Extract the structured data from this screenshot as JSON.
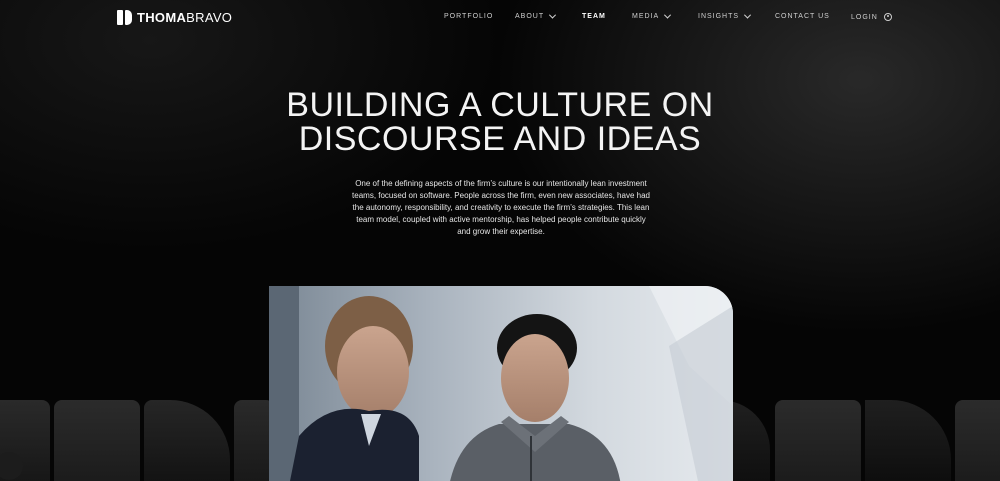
{
  "brand": {
    "logo_bold": "THOMA",
    "logo_regular": "BRAVO"
  },
  "nav": {
    "items": [
      {
        "label": "PORTFOLIO"
      },
      {
        "label": "ABOUT"
      },
      {
        "label": "TEAM"
      },
      {
        "label": "MEDIA"
      },
      {
        "label": "INSIGHTS"
      },
      {
        "label": "CONTACT US"
      },
      {
        "label": "LOGIN"
      }
    ]
  },
  "hero": {
    "title_line1": "BUILDING A CULTURE ON",
    "title_line2": "DISCOURSE AND IDEAS",
    "body": "One of the defining aspects of the firm’s culture is our intentionally lean investment teams, focused on software. People across the firm, even new associates, have had the autonomy, responsibility, and creativity to execute the firm’s strategies. This lean team model, coupled with active mentorship, has helped people contribute quickly and grow their expertise."
  },
  "icons": {
    "about_chevron": "chevron-down-icon",
    "media_chevron": "chevron-down-icon",
    "insights_chevron": "chevron-down-icon",
    "login": "user-circle-icon"
  },
  "colors": {
    "background": "#000000",
    "text": "#ffffff",
    "nav_text": "#cfcfcf"
  }
}
